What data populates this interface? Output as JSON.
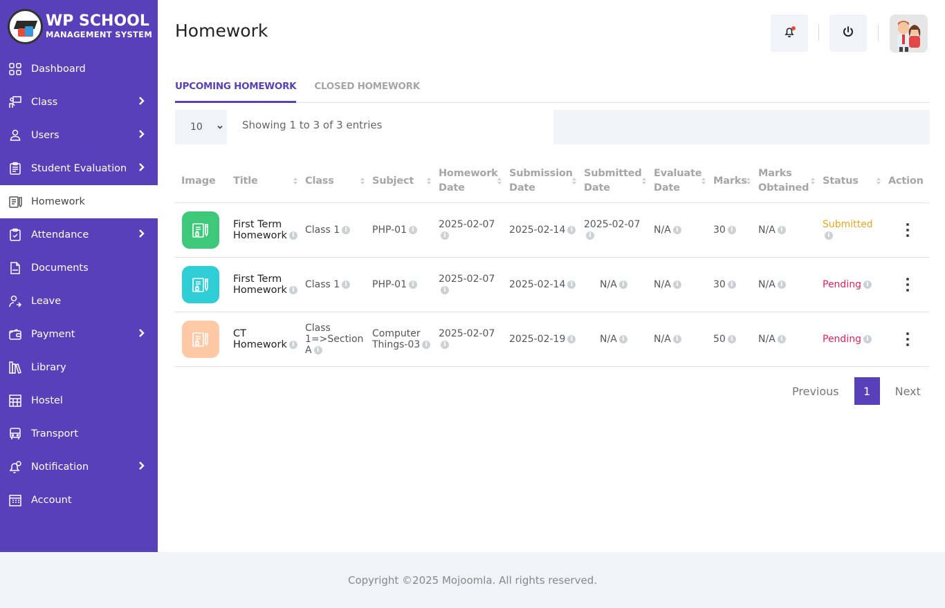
{
  "brand": {
    "title": "WP SCHOOL",
    "subtitle": "MANAGEMENT SYSTEM"
  },
  "sidebar": {
    "items": [
      {
        "label": "Dashboard",
        "icon": "dashboard-icon",
        "submenu": false
      },
      {
        "label": "Class",
        "icon": "class-icon",
        "submenu": true
      },
      {
        "label": "Users",
        "icon": "user-icon",
        "submenu": true
      },
      {
        "label": "Student Evaluation",
        "icon": "evaluation-icon",
        "submenu": true
      },
      {
        "label": "Homework",
        "icon": "homework-icon",
        "submenu": false,
        "active": true
      },
      {
        "label": "Attendance",
        "icon": "attendance-icon",
        "submenu": true
      },
      {
        "label": "Documents",
        "icon": "documents-icon",
        "submenu": false
      },
      {
        "label": "Leave",
        "icon": "leave-icon",
        "submenu": false
      },
      {
        "label": "Payment",
        "icon": "payment-icon",
        "submenu": true
      },
      {
        "label": "Library",
        "icon": "library-icon",
        "submenu": false
      },
      {
        "label": "Hostel",
        "icon": "hostel-icon",
        "submenu": false
      },
      {
        "label": "Transport",
        "icon": "transport-icon",
        "submenu": false
      },
      {
        "label": "Notification",
        "icon": "notification-icon",
        "submenu": true
      },
      {
        "label": "Account",
        "icon": "account-icon",
        "submenu": false
      }
    ]
  },
  "header": {
    "title": "Homework"
  },
  "tabs": [
    {
      "label": "UPCOMING HOMEWORK",
      "active": true
    },
    {
      "label": "CLOSED HOMEWORK",
      "active": false
    }
  ],
  "table_controls": {
    "page_length": "10",
    "info": "Showing 1 to 3 of 3 entries",
    "search_value": ""
  },
  "table": {
    "headers": [
      "Image",
      "Title",
      "Class",
      "Subject",
      "Homework Date",
      "Submission Date",
      "Submitted Date",
      "Evaluate Date",
      "Marks",
      "Marks Obtained",
      "Status",
      "Action"
    ],
    "rows": [
      {
        "icon_color": "#3ec97a",
        "title": "First Term Homework",
        "class": "Class 1",
        "subject": "PHP-01",
        "homework_date": "2025-02-07",
        "submission_date": "2025-02-14",
        "submitted_date": "2025-02-07",
        "evaluate_date": "N/A",
        "marks": "30",
        "marks_obtained": "N/A",
        "status": "Submitted"
      },
      {
        "icon_color": "#2fcdd5",
        "title": "First Term Homework",
        "class": "Class 1",
        "subject": "PHP-01",
        "homework_date": "2025-02-07",
        "submission_date": "2025-02-14",
        "submitted_date": "N/A",
        "evaluate_date": "N/A",
        "marks": "30",
        "marks_obtained": "N/A",
        "status": "Pending"
      },
      {
        "icon_color": "#ffc9a5",
        "title": "CT Homework",
        "class": "Class 1=>Section A",
        "subject": "Computer Things-03",
        "homework_date": "2025-02-07",
        "submission_date": "2025-02-19",
        "submitted_date": "N/A",
        "evaluate_date": "N/A",
        "marks": "50",
        "marks_obtained": "N/A",
        "status": "Pending"
      }
    ]
  },
  "pagination": {
    "previous": "Previous",
    "current": "1",
    "next": "Next"
  },
  "footer": {
    "text": "Copyright ©2025 Mojoomla. All rights reserved."
  },
  "colors": {
    "sidebar": "#5840bb",
    "accent": "#5840bb",
    "submitted": "#f0a417",
    "pending": "#e0225a"
  }
}
